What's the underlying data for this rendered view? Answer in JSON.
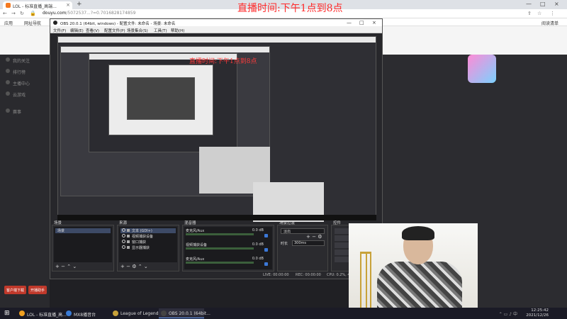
{
  "overlay_title": "直播时间:下午1点到8点",
  "browser": {
    "tab_title": "LOL - 标准直播_高端...",
    "url_host": "douyu.com",
    "url_path": "/5072537...?=0.7016828174859",
    "bookmarks": [
      "应用",
      "网址导航"
    ],
    "bookmark_right": "阅读清单"
  },
  "obs": {
    "title": "OBS 20.0.1 (64bit, windows) - 配置文件: 未命名 - 场景: 未命名",
    "menu": [
      "文件(F)",
      "编辑(E)",
      "查看(V)",
      "配置文件(P)",
      "场景集合(S)",
      "工具(T)",
      "帮助(H)"
    ],
    "preview_title": "直播时间:下午1点到8点",
    "docks": {
      "scenes": "场景",
      "sources": "来源",
      "mixer": "混音器",
      "transitions": "场景过渡",
      "controls": "控件"
    },
    "scene_item": "场景",
    "sources": [
      "文本 (GDI+)",
      "视频捕获设备",
      "窗口捕获",
      "显示器捕获"
    ],
    "mixer": [
      {
        "name": "麦克风/Aux",
        "db": "0.0 dB"
      },
      {
        "name": "视频捕获设备",
        "db": "0.0 dB"
      },
      {
        "name": "麦克风/Aux",
        "db": "0.0 dB"
      }
    ],
    "transition": "淡出",
    "duration_label": "时长",
    "duration": "300ms",
    "status": {
      "live": "LIVE: 00:00:00",
      "rec": "REC: 00:00:00",
      "cpu": "CPU: 0.2%, 40..."
    }
  },
  "taskbar": {
    "tasks": [
      {
        "label": "LOL - 标准直播_高...",
        "color": "#f0a020"
      },
      {
        "label": "MX8播音台",
        "color": "#3a7bd5"
      },
      {
        "label": "League of Legends",
        "color": "#c8a23a"
      },
      {
        "label": "OBS 20.0.1 (64bit...",
        "color": "#444444"
      }
    ],
    "time": "12:25:42",
    "date": "2021/12/26"
  },
  "page_sidebar": [
    "我的关注",
    "排行榜",
    "主播中心",
    "云游戏",
    "赛事"
  ],
  "page_sidebar_btns": [
    "客户端下载",
    "开播助手"
  ]
}
